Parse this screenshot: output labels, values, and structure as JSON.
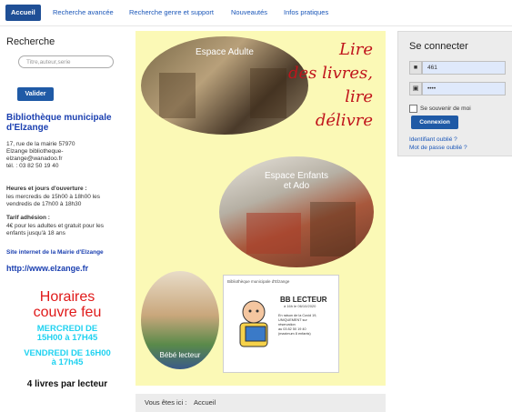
{
  "nav": {
    "items": [
      "Accueil",
      "Recherche avancée",
      "Recherche genre et support",
      "Nouveautés",
      "Infos pratiques"
    ]
  },
  "sidebar": {
    "search_heading": "Recherche",
    "search_placeholder": "Titre,auteur,serie",
    "search_button": "Valider",
    "library_name": "Bibliothèque municipale d'Elzange",
    "address_lines": [
      "17, rue de la mairie 57970",
      "Elzange bibliotheque-",
      "elzange@wanadoo.fr",
      "tél. : 03 82 50 19 40"
    ],
    "hours_title": "Heures et jours d'ouverture :",
    "hours_lines": [
      "les mercredis de 15h00 à 18h00 les",
      "vendredis de 17h00 à 18h30"
    ],
    "tarif_title": "Tarif adhésion :",
    "tarif_lines": [
      "4€ pour les adultes et gratuit pour les",
      "enfants jusqu'à 18 ans"
    ],
    "site_link": "Site internet de la Mairie d'Elzange",
    "site_url": "http://www.elzange.fr",
    "covid_title_lines": [
      "Horaires",
      "couvre feu"
    ],
    "covid_wed_lines": [
      "MERCREDI DE",
      "15H00 à 17H45"
    ],
    "covid_fri_lines": [
      "VENDREDI DE 16H00",
      "à 17h45"
    ],
    "covid_limit": "4 livres par lecteur"
  },
  "poster": {
    "photo_adult_caption": "Espace Adulte",
    "photo_kids_caption_lines": [
      "Espace Enfants",
      "et Ado"
    ],
    "photo_baby_caption": "Bébé lecteur",
    "slogan_lines": [
      "Lire",
      "des livres,",
      "lire",
      "délivre"
    ],
    "flyer_header": "Bibliothèque municipale d'Elzange",
    "flyer_brand": "BB LECTEUR",
    "flyer_brand_sub": "à 16h le 06/10/2020",
    "flyer_text_lines": [
      "En raison de la Covid 19,",
      "UNIQUEMENT sur",
      "réservation",
      "au 03 82 50 19 40",
      "(maximum 8 enfants)"
    ]
  },
  "breadcrumb": {
    "label": "Vous êtes ici :",
    "current": "Accueil"
  },
  "login": {
    "title": "Se connecter",
    "username_value": "461",
    "password_value": "••••",
    "remember_label": "Se souvenir de moi",
    "submit_label": "Connexion",
    "forgot_user": "Identifiant oublié ?",
    "forgot_password": "Mot de passe oublié ?"
  },
  "colors": {
    "accent": "#1f4f96",
    "link": "#1a56b8",
    "poster_bg": "#fbf9b6",
    "slogan": "#c0141c",
    "covid_red": "#e01a1a",
    "covid_cyan": "#20d2f0"
  }
}
